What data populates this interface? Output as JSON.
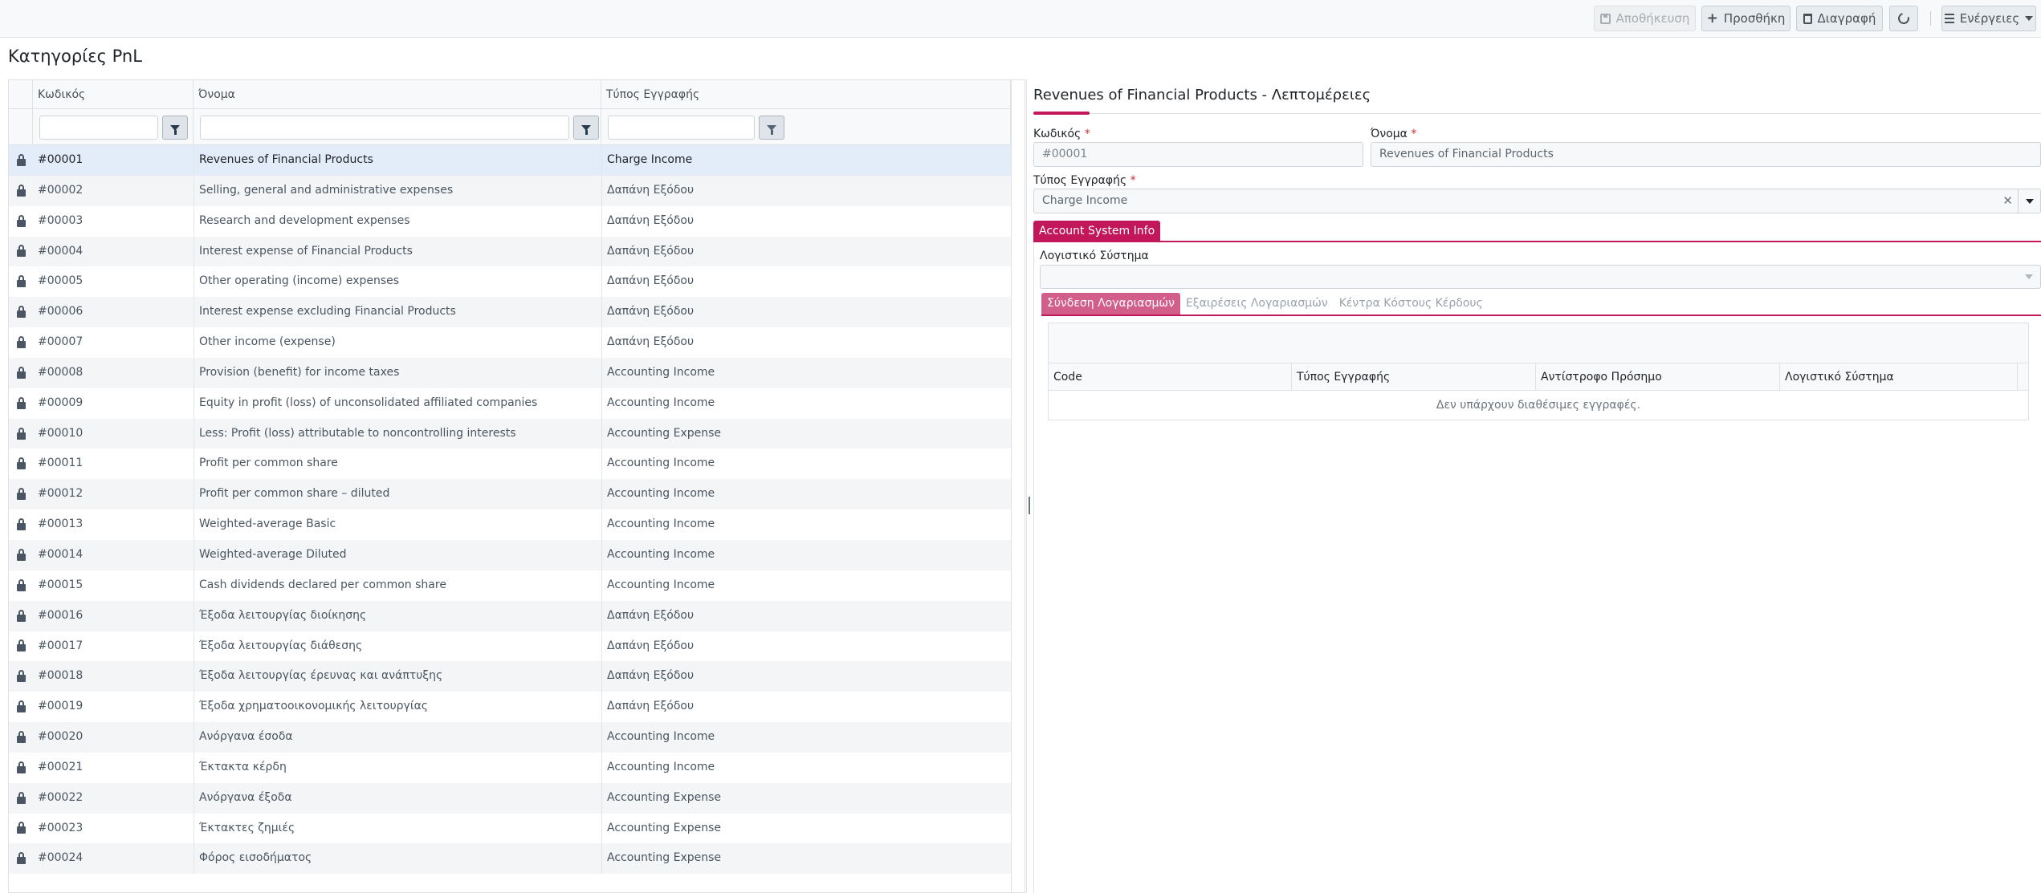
{
  "toolbar": {
    "save_label": "Αποθήκευση",
    "add_label": "Προσθήκη",
    "delete_label": "Διαγραφή",
    "actions_label": "Ενέργειες"
  },
  "page": {
    "title": "Κατηγορίες PnL"
  },
  "grid": {
    "columns": [
      "Κωδικός",
      "Όνομα",
      "Τύπος Εγγραφής"
    ],
    "rows": [
      {
        "code": "#00001",
        "name": "Revenues of Financial Products",
        "type": "Charge Income"
      },
      {
        "code": "#00002",
        "name": "Selling, general and administrative expenses",
        "type": "Δαπάνη Εξόδου"
      },
      {
        "code": "#00003",
        "name": "Research and development expenses",
        "type": "Δαπάνη Εξόδου"
      },
      {
        "code": "#00004",
        "name": "Interest expense of Financial Products",
        "type": "Δαπάνη Εξόδου"
      },
      {
        "code": "#00005",
        "name": "Other operating (income) expenses",
        "type": "Δαπάνη Εξόδου"
      },
      {
        "code": "#00006",
        "name": "Interest expense excluding Financial Products",
        "type": "Δαπάνη Εξόδου"
      },
      {
        "code": "#00007",
        "name": "Other income (expense)",
        "type": "Δαπάνη Εξόδου"
      },
      {
        "code": "#00008",
        "name": "Provision (benefit) for income taxes",
        "type": "Accounting Income"
      },
      {
        "code": "#00009",
        "name": "Equity in profit (loss) of unconsolidated affiliated companies",
        "type": "Accounting Income"
      },
      {
        "code": "#00010",
        "name": "Less: Profit (loss) attributable to noncontrolling interests",
        "type": "Accounting Expense"
      },
      {
        "code": "#00011",
        "name": "Profit per common share",
        "type": "Accounting Income"
      },
      {
        "code": "#00012",
        "name": "Profit per common share – diluted",
        "type": "Accounting Income"
      },
      {
        "code": "#00013",
        "name": "Weighted-average Basic",
        "type": "Accounting Income"
      },
      {
        "code": "#00014",
        "name": "Weighted-average Diluted",
        "type": "Accounting Income"
      },
      {
        "code": "#00015",
        "name": "Cash dividends declared per common share",
        "type": "Accounting Income"
      },
      {
        "code": "#00016",
        "name": "Έξοδα λειτουργίας διοίκησης",
        "type": "Δαπάνη Εξόδου"
      },
      {
        "code": "#00017",
        "name": "Έξοδα λειτουργίας διάθεσης",
        "type": "Δαπάνη Εξόδου"
      },
      {
        "code": "#00018",
        "name": "Έξοδα λειτουργίας έρευνας και ανάπτυξης",
        "type": "Δαπάνη Εξόδου"
      },
      {
        "code": "#00019",
        "name": "Έξοδα χρηματοοικονομικής λειτουργίας",
        "type": "Δαπάνη Εξόδου"
      },
      {
        "code": "#00020",
        "name": "Ανόργανα έσοδα",
        "type": "Accounting Income"
      },
      {
        "code": "#00021",
        "name": "Έκτακτα κέρδη",
        "type": "Accounting Income"
      },
      {
        "code": "#00022",
        "name": "Ανόργανα έξοδα",
        "type": "Accounting Expense"
      },
      {
        "code": "#00023",
        "name": "Έκτακτες ζημιές",
        "type": "Accounting Expense"
      },
      {
        "code": "#00024",
        "name": "Φόρος εισοδήματος",
        "type": "Accounting Expense"
      }
    ]
  },
  "detail": {
    "title": "Revenues of Financial Products - Λεπτομέρειες",
    "code_label": "Κωδικός",
    "code_value": "#00001",
    "name_label": "Όνομα",
    "name_value": "Revenues of Financial Products",
    "type_label": "Τύπος Εγγραφής",
    "type_value": "Charge Income",
    "required_mark": "*",
    "section_tab": "Account System Info",
    "account_system_label": "Λογιστικό Σύστημα",
    "account_system_value": "",
    "inner_tabs": [
      "Σύνδεση Λογαριασμών",
      "Εξαιρέσεις Λογαριασμών",
      "Κέντρα Κόστους Κέρδους"
    ],
    "subgrid": {
      "columns": [
        "Code",
        "Τύπος Εγγραφής",
        "Αντίστροφο Πρόσημο",
        "Λογιστικό Σύστημα"
      ],
      "empty_message": "Δεν υπάρχουν διαθέσιμες εγγραφές."
    }
  },
  "colors": {
    "accent": "#c2185b",
    "selected_row": "#e3edf9"
  }
}
